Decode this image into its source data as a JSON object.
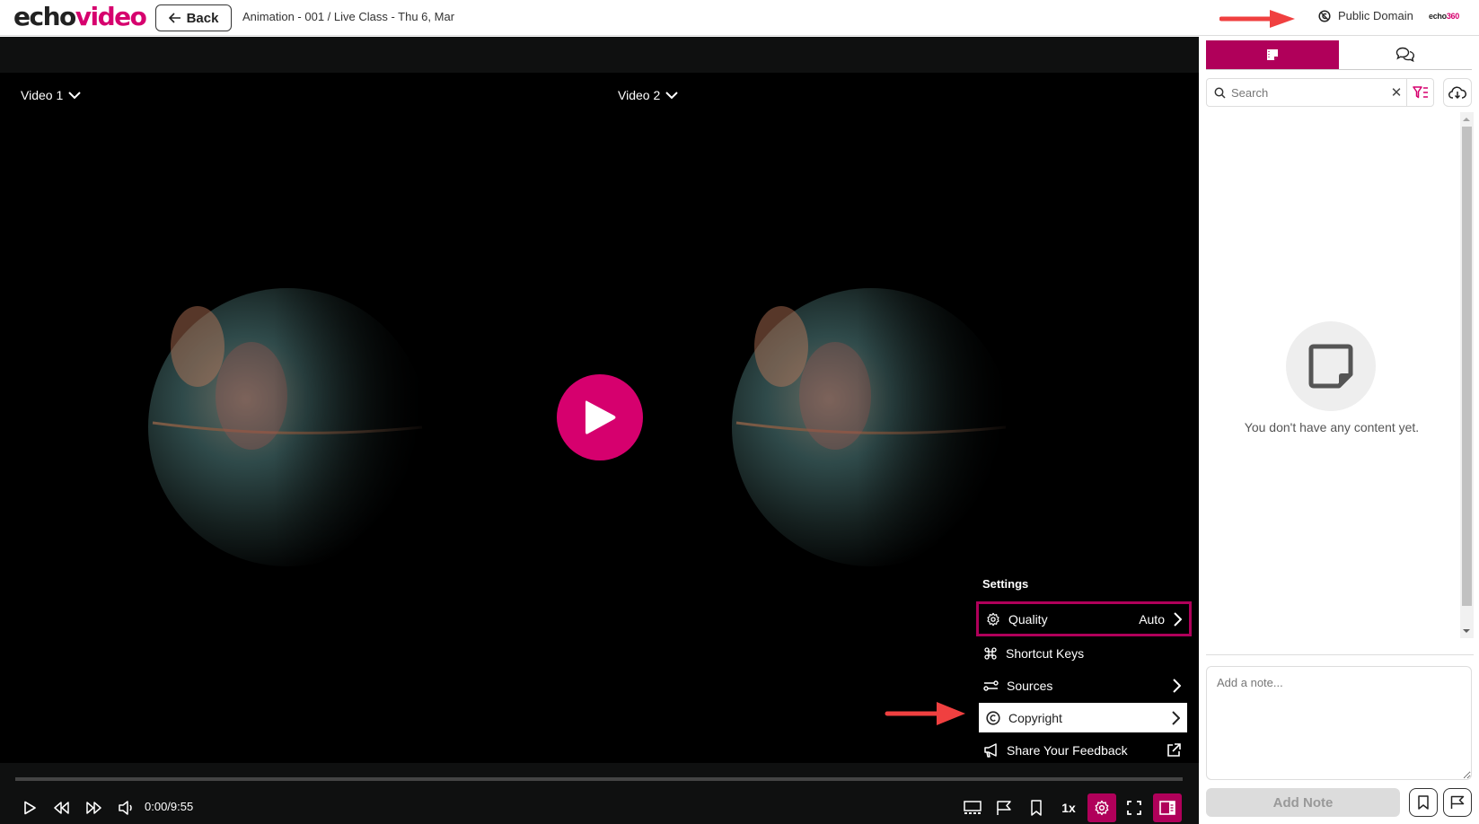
{
  "app": {
    "logo_echo": "echo",
    "logo_video": "video",
    "brand_small_a": "echo",
    "brand_small_b": "360"
  },
  "header": {
    "back_label": "Back",
    "breadcrumb": "Animation - 001 / Live Class - Thu 6, Mar",
    "license_label": "Public Domain",
    "license_icon": "public-domain-icon"
  },
  "player": {
    "sources": [
      {
        "label": "Video 1"
      },
      {
        "label": "Video 2"
      }
    ],
    "big_play_icon": "play-icon",
    "time": "0:00/9:55",
    "progress_percent": 0,
    "speed": "1x",
    "controls_left": [
      "play-icon",
      "rewind-icon",
      "fast-forward-icon",
      "volume-icon"
    ],
    "controls_right": [
      "captions-icon",
      "flag-icon",
      "bookmark-icon",
      "speed",
      "settings-icon",
      "fullscreen-icon",
      "sidebar-toggle-icon"
    ]
  },
  "settings_menu": {
    "title": "Settings",
    "items": [
      {
        "label": "Quality",
        "value": "Auto",
        "icon": "gear-icon",
        "state": "focused"
      },
      {
        "label": "Shortcut Keys",
        "icon": "command-icon"
      },
      {
        "label": "Sources",
        "icon": "sliders-icon"
      },
      {
        "label": "Copyright",
        "icon": "copyright-icon",
        "state": "highlighted"
      },
      {
        "label": "Share Your Feedback",
        "icon": "megaphone-icon"
      }
    ]
  },
  "sidebar": {
    "tabs": [
      {
        "name": "notes",
        "icon": "note-icon",
        "active": true
      },
      {
        "name": "discussions",
        "icon": "chat-icon",
        "active": false
      }
    ],
    "search_placeholder": "Search",
    "empty_text": "You don't have any content yet.",
    "note_placeholder": "Add a note...",
    "add_note_label": "Add Note"
  },
  "colors": {
    "brand": "#d6006e",
    "accent": "#b0005a",
    "annotation_arrow": "#f04040"
  }
}
